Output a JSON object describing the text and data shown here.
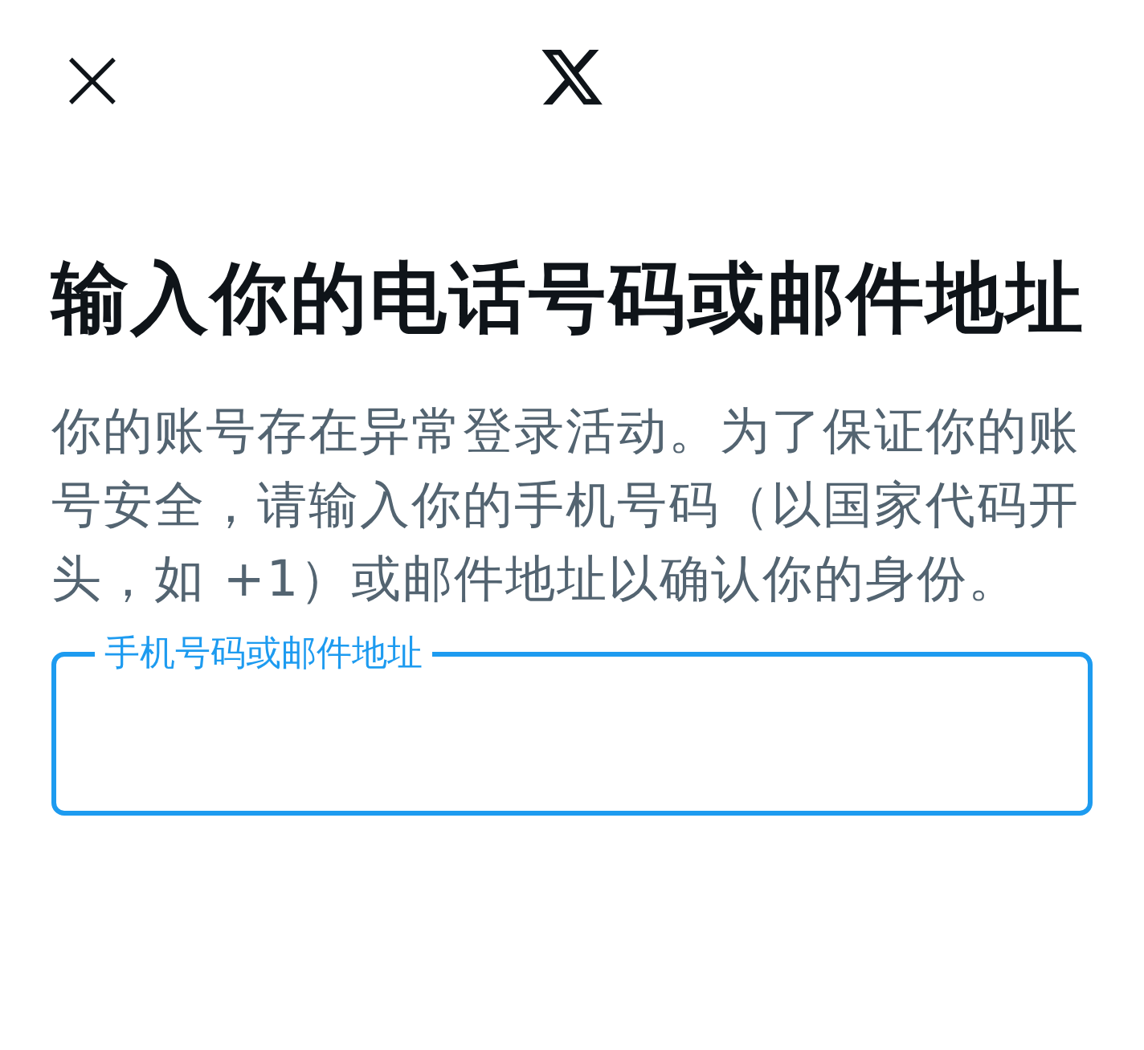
{
  "header": {
    "close": "×"
  },
  "title": "输入你的电话号码或邮件地址",
  "description": "你的账号存在异常登录活动。为了保证你的账号安全，请输入你的手机号码（以国家代码开头，如 +1）或邮件地址以确认你的身份。",
  "field": {
    "label": "手机号码或邮件地址",
    "focused": true
  }
}
